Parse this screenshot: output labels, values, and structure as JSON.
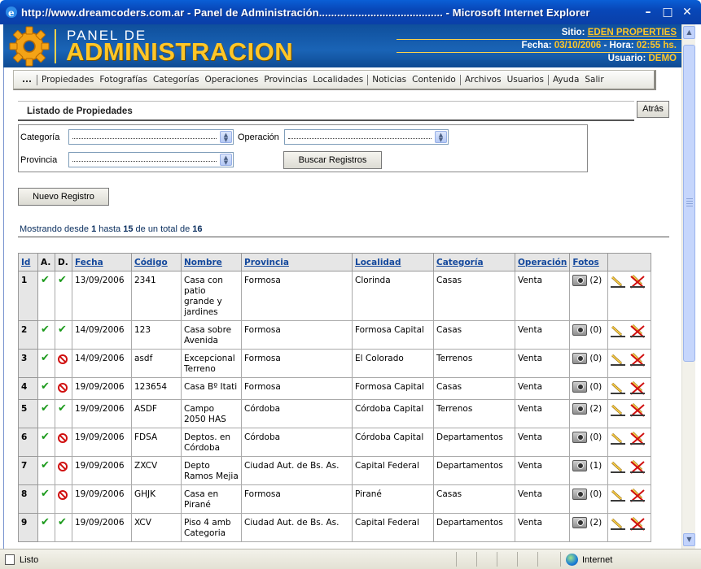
{
  "window": {
    "title": "http://www.dreamcoders.com.ar - Panel de Administración......................................... - Microsoft Internet Explorer",
    "buttons": [
      "minimize",
      "maximize",
      "close"
    ]
  },
  "header": {
    "logo_small": "PANEL DE",
    "logo_big": "ADMINISTRACION",
    "site_label": "Sitio:",
    "site_value": "EDEN PROPERTIES",
    "fecha_label": "Fecha:",
    "fecha_value": "03/10/2006",
    "hora_label": " - Hora:",
    "hora_value": "02:55 hs.",
    "usuario_label": "Usuario:",
    "usuario_value": "DEMO"
  },
  "menu": {
    "first": "...",
    "items": [
      "Propiedades",
      "Fotografías",
      "Categorías",
      "Operaciones",
      "Provincias",
      "Localidades",
      "Noticias",
      "Contenido",
      "Archivos",
      "Usuarios",
      "Ayuda",
      "Salir"
    ]
  },
  "page": {
    "section_title": "Listado de Propiedades",
    "back_button": "Atrás",
    "new_button": "Nuevo Registro",
    "search_button": "Buscar Registros"
  },
  "filters": {
    "categoria_label": "Categoría",
    "operacion_label": "Operación",
    "provincia_label": "Provincia"
  },
  "showing": {
    "prefix": "Mostrando desde ",
    "from": "1",
    "mid": " hasta ",
    "to": "15",
    "mid2": " de un total de ",
    "total": "16"
  },
  "table": {
    "headers": [
      "Id",
      "A.",
      "D.",
      "Fecha",
      "Código",
      "Nombre",
      "Provincia",
      "Localidad",
      "Categoría",
      "Operación",
      "Fotos",
      ""
    ],
    "rows": [
      {
        "id": "1",
        "a": true,
        "d": true,
        "fecha": "13/09/2006",
        "codigo": "2341",
        "nombre": "Casa con patio grande y jardines",
        "provincia": "Formosa",
        "localidad": "Clorinda",
        "categoria": "Casas",
        "operacion": "Venta",
        "fotos": "(2)"
      },
      {
        "id": "2",
        "a": true,
        "d": true,
        "fecha": "14/09/2006",
        "codigo": "123",
        "nombre": "Casa sobre Avenida",
        "provincia": "Formosa",
        "localidad": "Formosa Capital",
        "categoria": "Casas",
        "operacion": "Venta",
        "fotos": "(0)"
      },
      {
        "id": "3",
        "a": true,
        "d": false,
        "fecha": "14/09/2006",
        "codigo": "asdf",
        "nombre": "Excepcional Terreno",
        "provincia": "Formosa",
        "localidad": "El Colorado",
        "categoria": "Terrenos",
        "operacion": "Venta",
        "fotos": "(0)"
      },
      {
        "id": "4",
        "a": true,
        "d": false,
        "fecha": "19/09/2006",
        "codigo": "123654",
        "nombre": "Casa Bº Itati",
        "provincia": "Formosa",
        "localidad": "Formosa Capital",
        "categoria": "Casas",
        "operacion": "Venta",
        "fotos": "(0)"
      },
      {
        "id": "5",
        "a": true,
        "d": true,
        "fecha": "19/09/2006",
        "codigo": "ASDF",
        "nombre": "Campo 2050 HAS",
        "provincia": "Córdoba",
        "localidad": "Córdoba Capital",
        "categoria": "Terrenos",
        "operacion": "Venta",
        "fotos": "(2)"
      },
      {
        "id": "6",
        "a": true,
        "d": false,
        "fecha": "19/09/2006",
        "codigo": "FDSA",
        "nombre": "Deptos. en Córdoba",
        "provincia": "Córdoba",
        "localidad": "Córdoba Capital",
        "categoria": "Departamentos",
        "operacion": "Venta",
        "fotos": "(0)"
      },
      {
        "id": "7",
        "a": true,
        "d": false,
        "fecha": "19/09/2006",
        "codigo": "ZXCV",
        "nombre": "Depto Ramos Mejia",
        "provincia": "Ciudad Aut. de Bs. As.",
        "localidad": "Capital Federal",
        "categoria": "Departamentos",
        "operacion": "Venta",
        "fotos": "(1)"
      },
      {
        "id": "8",
        "a": true,
        "d": false,
        "fecha": "19/09/2006",
        "codigo": "GHJK",
        "nombre": "Casa en Pirané",
        "provincia": "Formosa",
        "localidad": "Pirané",
        "categoria": "Casas",
        "operacion": "Venta",
        "fotos": "(0)"
      },
      {
        "id": "9",
        "a": true,
        "d": true,
        "fecha": "19/09/2006",
        "codigo": "XCV",
        "nombre": "Piso 4 amb Categoria",
        "provincia": "Ciudad Aut. de Bs. As.",
        "localidad": "Capital Federal",
        "categoria": "Departamentos",
        "operacion": "Venta",
        "fotos": "(2)"
      }
    ]
  },
  "statusbar": {
    "left": "Listo",
    "zone": "Internet"
  },
  "colors": {
    "banner": "#1a64b6",
    "gold": "#ffc628",
    "link": "#14489c",
    "check": "#1c9a1c",
    "forbidden": "#d01010"
  },
  "icons": {
    "camera": "camera-icon",
    "edit": "edit-icon",
    "delete": "delete-icon",
    "check": "check-icon",
    "forbidden": "forbidden-icon"
  }
}
